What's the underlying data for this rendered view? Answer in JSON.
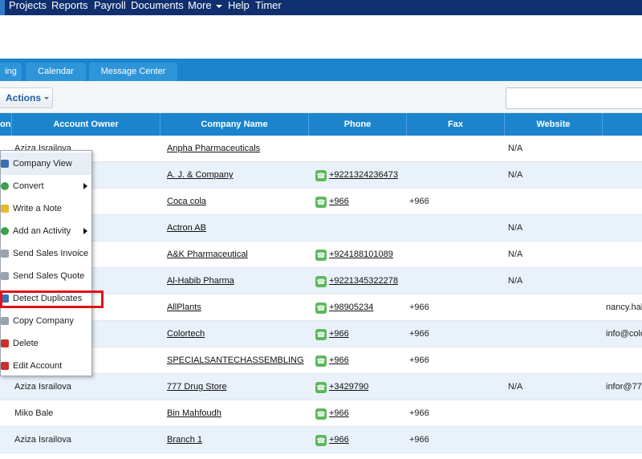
{
  "nav": {
    "items": [
      "Projects",
      "Reports",
      "Payroll",
      "Documents",
      "More",
      "Help",
      "Timer"
    ]
  },
  "tabs": [
    "ing",
    "Calendar",
    "Message Center"
  ],
  "toolbar": {
    "actions_label": "Actions"
  },
  "table": {
    "headers": [
      "on",
      "Account Owner",
      "Company Name",
      "Phone",
      "Fax",
      "Website",
      ""
    ],
    "rows": [
      {
        "owner": "Aziza Israilova",
        "company": "Anpha Pharmaceuticals",
        "phone": "",
        "fax": "",
        "website": "N/A",
        "email": ""
      },
      {
        "owner": "",
        "company": "A. J. & Company",
        "phone": "+9221324236473",
        "fax": "",
        "website": "N/A",
        "email": ""
      },
      {
        "owner": "",
        "company": "Coca cola",
        "phone": "+966",
        "fax": "+966",
        "website": "",
        "email": ""
      },
      {
        "owner": "",
        "company": "Actron AB",
        "phone": "",
        "fax": "",
        "website": "N/A",
        "email": ""
      },
      {
        "owner": "",
        "company": "A&K Pharmaceutical",
        "phone": "+924188101089",
        "fax": "",
        "website": "N/A",
        "email": ""
      },
      {
        "owner": "",
        "company": "Al-Habib Pharma",
        "phone": "+9221345322278",
        "fax": "",
        "website": "N/A",
        "email": ""
      },
      {
        "owner": "",
        "company": "AllPlants",
        "phone": "+98905234",
        "fax": "+966",
        "website": "",
        "email": "nancy.hal"
      },
      {
        "owner": "",
        "company": "Colortech",
        "phone": "+966",
        "fax": "+966",
        "website": "",
        "email": "info@colo"
      },
      {
        "owner": "",
        "company": "SPECIALSANTECHASSEMBLING",
        "phone": "+966",
        "fax": "+966",
        "website": "",
        "email": ""
      },
      {
        "owner": "Aziza Israilova",
        "company": "777 Drug Store",
        "phone": "+3429790",
        "fax": "",
        "website": "N/A",
        "email": "infor@777"
      },
      {
        "owner": "Miko Bale",
        "company": "Bin Mahfoudh",
        "phone": "+966",
        "fax": "+966",
        "website": "",
        "email": ""
      },
      {
        "owner": "Aziza Israilova",
        "company": "Branch 1",
        "phone": "+966",
        "fax": "+966",
        "website": "",
        "email": ""
      }
    ]
  },
  "context_menu": {
    "items": [
      {
        "label": "Company View",
        "icon": "home-icon",
        "submenu": false
      },
      {
        "label": "Convert",
        "icon": "convert-icon",
        "submenu": true
      },
      {
        "label": "Write a Note",
        "icon": "note-icon",
        "submenu": false
      },
      {
        "label": "Add an Activity",
        "icon": "add-icon",
        "submenu": true
      },
      {
        "label": "Send Sales Invoice",
        "icon": "invoice-icon",
        "submenu": false
      },
      {
        "label": "Send Sales Quote",
        "icon": "quote-icon",
        "submenu": false
      },
      {
        "label": "Detect Duplicates",
        "icon": "duplicates-icon",
        "submenu": false
      },
      {
        "label": "Copy Company",
        "icon": "copy-icon",
        "submenu": false
      },
      {
        "label": "Delete",
        "icon": "delete-icon",
        "submenu": false
      },
      {
        "label": "Edit Account",
        "icon": "edit-icon",
        "submenu": false
      }
    ]
  },
  "colors": {
    "nav_bg": "#0f2f6e",
    "header_bg": "#1b84cc",
    "highlight": "#e0121b",
    "phone_icon": "#5cb85c"
  }
}
